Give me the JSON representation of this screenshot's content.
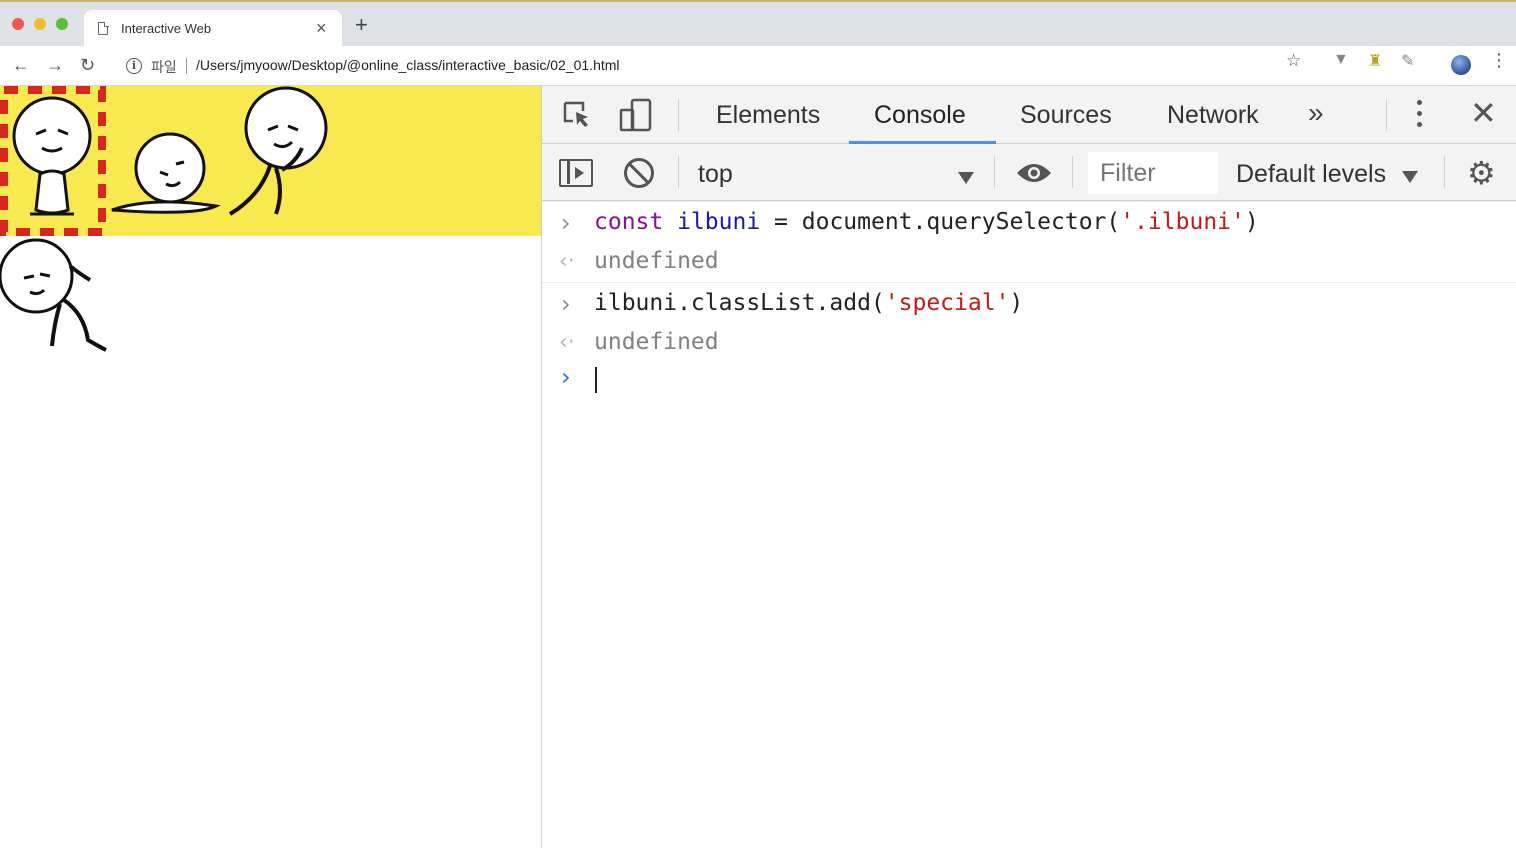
{
  "browser": {
    "tab_title": "Interactive Web",
    "tab_close": "×",
    "new_tab": "+",
    "nav": {
      "back": "←",
      "forward": "→",
      "reload": "↻"
    },
    "omnibox": {
      "scheme_label": "파일",
      "url": "/Users/jmyoow/Desktop/@online_class/interactive_basic/02_01.html"
    },
    "bookmark_star": "☆",
    "extensions": [
      "▼",
      "♜",
      "✎"
    ],
    "menu": "⋮"
  },
  "devtools": {
    "tabs": [
      "Elements",
      "Console",
      "Sources",
      "Network"
    ],
    "active_tab": "Console",
    "more_tabs": "»",
    "close": "✕",
    "console_toolbar": {
      "context": "top",
      "filter_placeholder": "Filter",
      "levels": "Default levels",
      "gear": "⚙"
    },
    "console": {
      "entries": [
        {
          "kind": "input",
          "chev": "›",
          "parts": [
            {
              "t": "const",
              "c": "kw"
            },
            {
              "t": " ",
              "c": ""
            },
            {
              "t": "ilbuni",
              "c": "var"
            },
            {
              "t": " = document.querySelector(",
              "c": ""
            },
            {
              "t": "'.ilbuni'",
              "c": "str"
            },
            {
              "t": ")",
              "c": ""
            }
          ]
        },
        {
          "kind": "result",
          "chev": "‹·",
          "parts": [
            {
              "t": "undefined",
              "c": "undef"
            }
          ]
        },
        {
          "kind": "input",
          "chev": "›",
          "parts": [
            {
              "t": "ilbuni.classList.add(",
              "c": ""
            },
            {
              "t": "'special'",
              "c": "str"
            },
            {
              "t": ")",
              "c": ""
            }
          ]
        },
        {
          "kind": "result",
          "chev": "‹·",
          "parts": [
            {
              "t": "undefined",
              "c": "undef"
            }
          ]
        }
      ],
      "prompt_chev": "›"
    }
  },
  "colors": {
    "page_band": "#f7e94f",
    "special_border": "#d9261c",
    "tab_underline": "#4d8ff0"
  }
}
